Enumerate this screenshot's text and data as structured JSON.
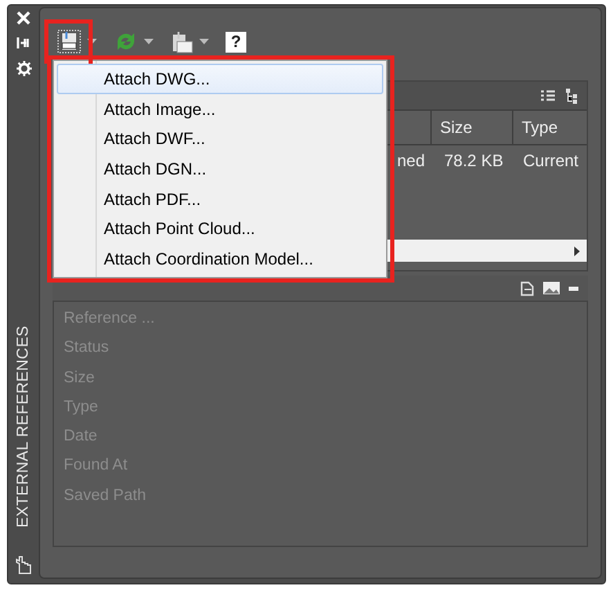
{
  "palette": {
    "title": "EXTERNAL REFERENCES"
  },
  "toolbar": {
    "help_glyph": "?"
  },
  "attach_menu": {
    "items": [
      {
        "label": "Attach DWG...",
        "selected": true
      },
      {
        "label": "Attach Image...",
        "selected": false
      },
      {
        "label": "Attach DWF...",
        "selected": false
      },
      {
        "label": "Attach DGN...",
        "selected": false
      },
      {
        "label": "Attach PDF...",
        "selected": false
      },
      {
        "label": "Attach Point Cloud...",
        "selected": false
      },
      {
        "label": "Attach Coordination Model...",
        "selected": false
      }
    ]
  },
  "file_references": {
    "columns": [
      "",
      "Size",
      "Type"
    ],
    "rows": [
      {
        "cells": [
          "ned",
          "78.2 KB",
          "Current"
        ]
      }
    ]
  },
  "details": {
    "fields": [
      "Reference ...",
      "Status",
      "Size",
      "Type",
      "Date",
      "Found At",
      "Saved Path"
    ]
  }
}
